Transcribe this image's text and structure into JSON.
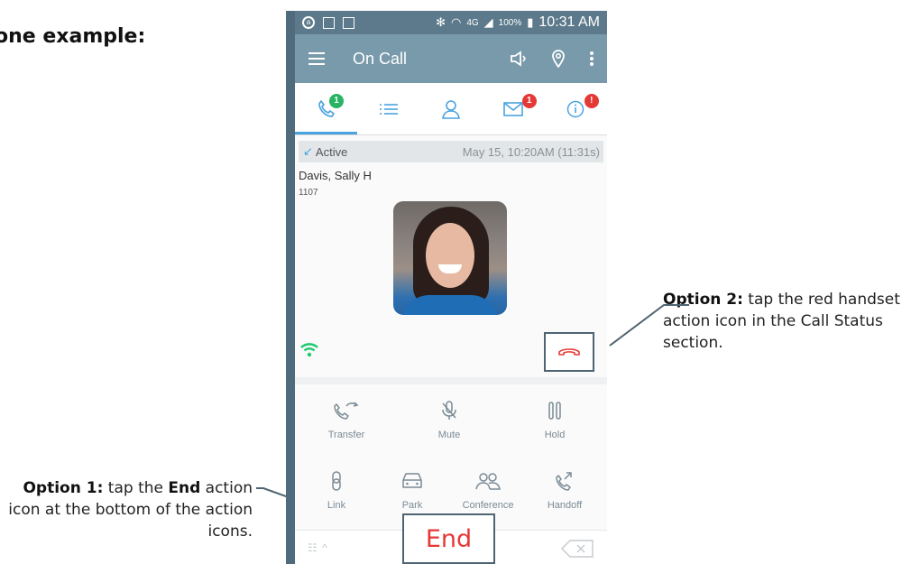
{
  "heading": "one example:",
  "callouts": {
    "option2": {
      "bold": "Option 2:",
      "text": " tap the red handset action icon in the Call Status section."
    },
    "option1": {
      "bold": "Option 1:",
      "pre": " tap the ",
      "bold2": "End",
      "text": " action icon at the bottom of the action icons."
    }
  },
  "status_bar": {
    "left_icons": [
      "app-icon",
      "screenshot-icon",
      "notification-icon"
    ],
    "network": "4G",
    "battery": "100%",
    "time": "10:31 AM"
  },
  "app_bar": {
    "title": "On Call",
    "actions": [
      "speaker-icon",
      "location-icon",
      "more-vert-icon"
    ]
  },
  "tabs": [
    {
      "icon": "phone-icon",
      "badge": "1",
      "badge_color": "#28b463",
      "active": true
    },
    {
      "icon": "list-icon",
      "badge": "",
      "active": false
    },
    {
      "icon": "contacts-icon",
      "badge": "",
      "active": false
    },
    {
      "icon": "mail-icon",
      "badge": "1",
      "badge_color": "#e53935",
      "active": false
    },
    {
      "icon": "info-icon",
      "badge": "!",
      "badge_color": "#e53935",
      "active": false
    }
  ],
  "call": {
    "state": "Active",
    "timestamp": "May 15, 10:20AM (11:31s)",
    "caller_name": "Davis, Sally H",
    "extension": "1107"
  },
  "actions_row1": [
    {
      "label": "Transfer",
      "icon": "transfer-icon"
    },
    {
      "label": "Mute",
      "icon": "mute-icon"
    },
    {
      "label": "Hold",
      "icon": "hold-icon"
    }
  ],
  "actions_row2": [
    {
      "label": "Link",
      "icon": "link-icon"
    },
    {
      "label": "Park",
      "icon": "park-icon"
    },
    {
      "label": "Conference",
      "icon": "conference-icon"
    },
    {
      "label": "Handoff",
      "icon": "handoff-icon"
    }
  ],
  "end_label": "End",
  "colors": {
    "accent": "#4aa3df",
    "end_red": "#e53935",
    "wifi_green": "#1ec971",
    "app_bar": "#789aab"
  }
}
